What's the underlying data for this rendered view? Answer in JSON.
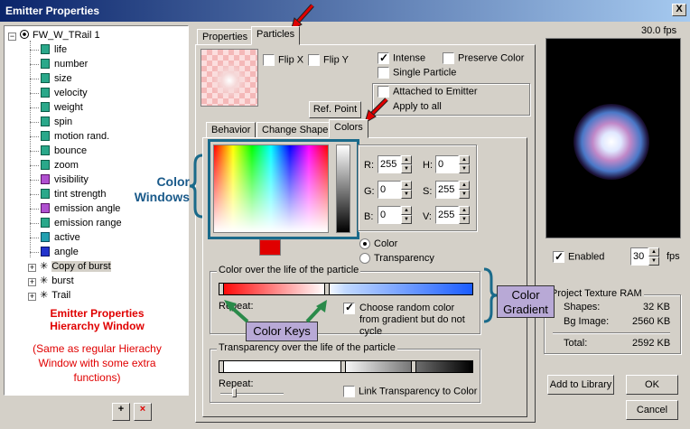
{
  "window": {
    "title": "Emitter Properties",
    "close_label": "X"
  },
  "tree": {
    "root": "FW_W_TRail 1",
    "children": [
      "life",
      "number",
      "size",
      "velocity",
      "weight",
      "spin",
      "motion rand.",
      "bounce",
      "zoom",
      "visibility",
      "tint strength",
      "emission angle",
      "emission range",
      "active",
      "angle"
    ],
    "siblings": [
      "Copy of burst",
      "burst",
      "Trail"
    ]
  },
  "hierarchy_note": {
    "title_line1": "Emitter Properties",
    "title_line2": "Hierarchy Window",
    "desc": "(Same as regular Hierachy Window with some extra functions)"
  },
  "bottom_buttons": {
    "add": "+",
    "remove": "×"
  },
  "top_tabs": [
    "Properties",
    "Particles"
  ],
  "flip": {
    "x": "Flip X",
    "y": "Flip Y"
  },
  "options": {
    "intense": "Intense",
    "preserve_color": "Preserve Color",
    "single_particle": "Single Particle",
    "attached": "Attached to Emitter",
    "apply_all": "Apply to all"
  },
  "ref_point": "Ref. Point",
  "sub_tabs": [
    "Behavior",
    "Change Shape",
    "Colors"
  ],
  "rgb": {
    "r_label": "R:",
    "r": "255",
    "g_label": "G:",
    "g": "0",
    "b_label": "B:",
    "b": "0"
  },
  "hsv": {
    "h_label": "H:",
    "h": "0",
    "s_label": "S:",
    "s": "255",
    "v_label": "V:",
    "v": "255"
  },
  "mode": {
    "color": "Color",
    "transparency": "Transparency"
  },
  "color_life": {
    "title": "Color over the life of the particle",
    "repeat": "Repeat:",
    "random": "Choose random color from gradient but do not cycle"
  },
  "transparency_life": {
    "title": "Transparency over the life of the particle",
    "repeat": "Repeat:",
    "link": "Link Transparency to Color"
  },
  "preview": {
    "fps": "30.0 fps",
    "enabled": "Enabled",
    "fps_value": "30",
    "fps_unit": "fps"
  },
  "ram": {
    "title": "Project Texture RAM",
    "shapes_label": "Shapes:",
    "shapes": "32 KB",
    "bg_label": "Bg Image:",
    "bg": "2560 KB",
    "total_label": "Total:",
    "total": "2592 KB"
  },
  "buttons": {
    "add_library": "Add to Library",
    "ok": "OK",
    "cancel": "Cancel"
  },
  "callouts": {
    "color_windows_1": "Color",
    "color_windows_2": "Windows",
    "color_keys": "Color Keys",
    "color_gradient_1": "Color",
    "color_gradient_2": "Gradient"
  },
  "colors": {
    "title_start": "#0a246a",
    "red": "#e00000",
    "callout_blue": "#1a5a8a",
    "callout_box": "#b8a9d6",
    "highlight": "#1a6a8a"
  }
}
